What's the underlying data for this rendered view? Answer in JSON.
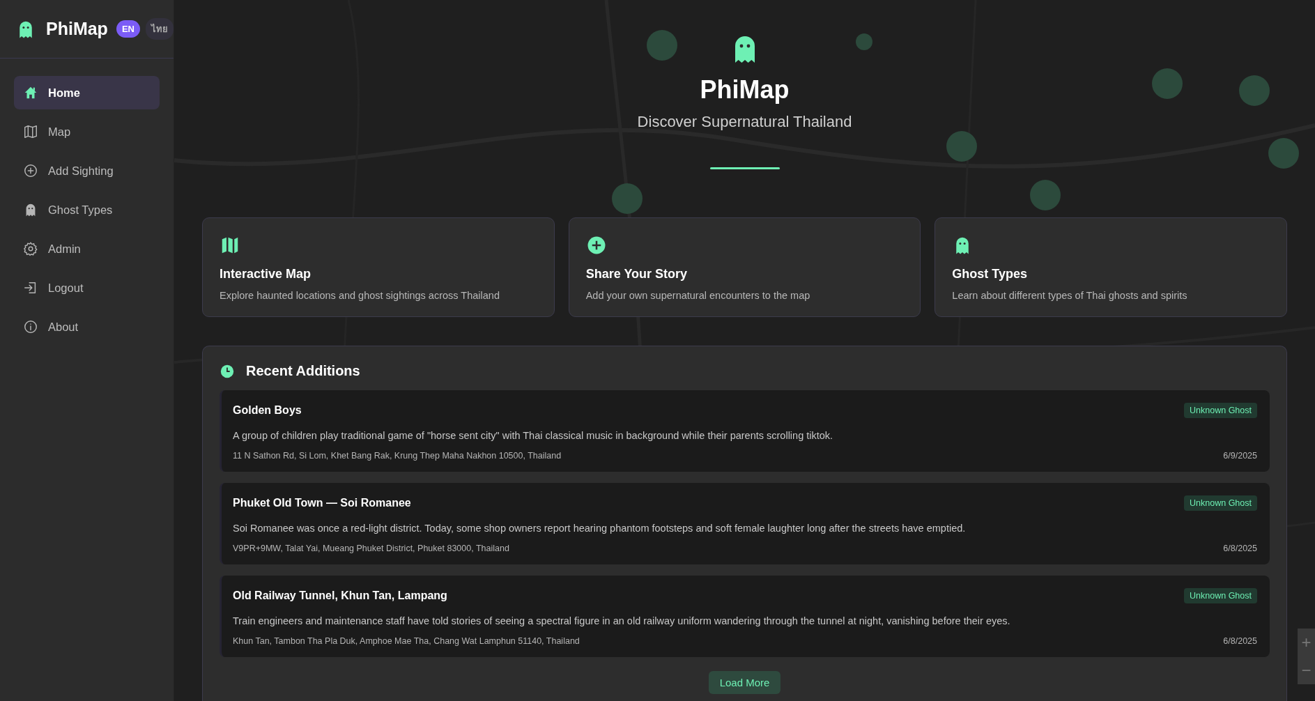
{
  "brand": {
    "name": "PhiMap",
    "languages": [
      {
        "label": "EN",
        "selected": true
      },
      {
        "label": "ไทย",
        "selected": false
      }
    ]
  },
  "nav": [
    {
      "label": "Home",
      "kind": "home",
      "selected": true
    },
    {
      "label": "Map",
      "kind": "map",
      "selected": false
    },
    {
      "label": "Add Sighting",
      "kind": "plus",
      "selected": false
    },
    {
      "label": "Ghost Types",
      "kind": "ghost",
      "selected": false
    },
    {
      "label": "Admin",
      "kind": "gear",
      "selected": false
    },
    {
      "label": "Logout",
      "kind": "logout",
      "selected": false
    },
    {
      "label": "About",
      "kind": "info",
      "selected": false
    }
  ],
  "hero": {
    "title": "PhiMap",
    "subtitle": "Discover Supernatural Thailand"
  },
  "features": [
    {
      "kind": "map",
      "title": "Interactive Map",
      "description": "Explore haunted locations and ghost sightings across Thailand"
    },
    {
      "kind": "plus",
      "title": "Share Your Story",
      "description": "Add your own supernatural encounters to the map"
    },
    {
      "kind": "ghost",
      "title": "Ghost Types",
      "description": "Learn about different types of Thai ghosts and spirits"
    }
  ],
  "recent": {
    "title": "Recent Additions",
    "items": [
      {
        "title": "Golden Boys",
        "tag": "Unknown Ghost",
        "description": "A group of children play traditional game of \"horse sent city\" with Thai classical music in background while their parents scrolling tiktok.",
        "address": "11 N Sathon Rd, Si Lom, Khet Bang Rak, Krung Thep Maha Nakhon 10500, Thailand",
        "date": "6/9/2025"
      },
      {
        "title": "Phuket Old Town — Soi Romanee",
        "tag": "Unknown Ghost",
        "description": "Soi Romanee was once a red-light district. Today, some shop owners report hearing phantom footsteps and soft female laughter long after the streets have emptied.",
        "address": "V9PR+9MW, Talat Yai, Mueang Phuket District, Phuket 83000, Thailand",
        "date": "6/8/2025"
      },
      {
        "title": "Old Railway Tunnel, Khun Tan, Lampang",
        "tag": "Unknown Ghost",
        "description": "Train engineers and maintenance staff have told stories of seeing a spectral figure in an old railway uniform wandering through the tunnel at night, vanishing before their eyes.",
        "address": "Khun Tan, Tambon Tha Pla Duk, Amphoe Mae Tha, Chang Wat Lamphun 51140, Thailand",
        "date": "6/8/2025"
      }
    ],
    "load_more": "Load More"
  },
  "map_controls": [
    "+",
    "−"
  ]
}
